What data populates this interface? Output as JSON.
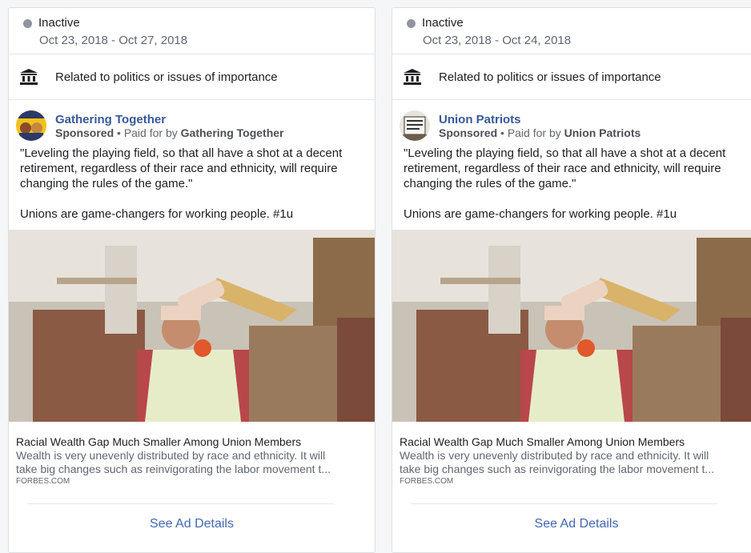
{
  "ads": [
    {
      "status": "Inactive",
      "dates": "Oct 23, 2018 - Oct 27, 2018",
      "category": "Related to politics or issues of importance",
      "page_name": "Gathering Together",
      "sponsored": "Sponsored",
      "separator": " • ",
      "paid_for": "Paid for by ",
      "sponsor": "Gathering Together",
      "text1": "\"Leveling the playing field, so that all have a shot at a decent retirement, regardless of their race and ethnicity, will require changing the rules of the game.\"",
      "text2": "Unions are game-changers for working people. #1u",
      "link_title": "Racial Wealth Gap Much Smaller Among Union Members",
      "link_desc1": "Wealth is very unevenly distributed by race and ethnicity. It will",
      "link_desc2": "take big changes such as reinvigorating the labor movement t...",
      "link_domain": "FORBES.COM",
      "cta": "See Ad Details"
    },
    {
      "status": "Inactive",
      "dates": "Oct 23, 2018 - Oct 24, 2018",
      "category": "Related to politics or issues of importance",
      "page_name": "Union Patriots",
      "sponsored": "Sponsored",
      "separator": " • ",
      "paid_for": "Paid for by ",
      "sponsor": "Union Patriots",
      "text1": "\"Leveling the playing field, so that all have a shot at a decent retirement, regardless of their race and ethnicity, will require changing the rules of the game.\"",
      "text2": "Unions are game-changers for working people. #1u",
      "link_title": "Racial Wealth Gap Much Smaller Among Union Members",
      "link_desc1": "Wealth is very unevenly distributed by race and ethnicity. It will",
      "link_desc2": "take big changes such as reinvigorating the labor movement t...",
      "link_domain": "FORBES.COM",
      "cta": "See Ad Details"
    }
  ],
  "icons": {
    "category": "government-building-icon",
    "status": "status-dot-icon"
  },
  "colors": {
    "link_blue": "#4267b2",
    "page_blue": "#385898",
    "inactive_gray": "#90949c"
  }
}
